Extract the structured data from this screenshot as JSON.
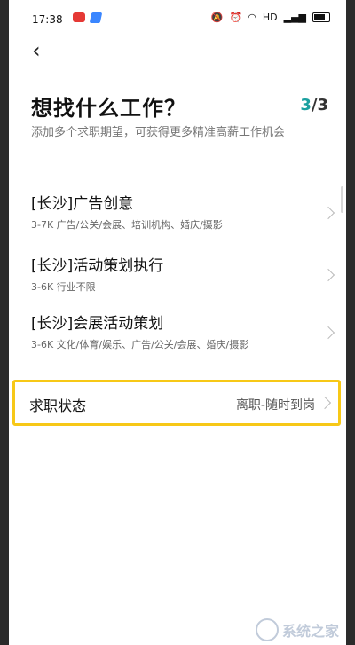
{
  "status_bar": {
    "time": "17:38",
    "right_text": "HD",
    "icons": [
      "notification-red-app-icon",
      "blue-app-icon",
      "bell-icon",
      "alarm-icon",
      "wifi-icon",
      "signal-icon",
      "battery-icon"
    ]
  },
  "header": {
    "back_icon": "chevron-left-icon",
    "title": "想找什么工作？",
    "step_current": "3",
    "step_separator": "/",
    "step_total": "3",
    "subtitle": "添加多个求职期望，可获得更多精准高薪工作机会"
  },
  "jobs": [
    {
      "title": "[长沙]广告创意",
      "desc": "3-7K 广告/公关/会展、培训机构、婚庆/摄影"
    },
    {
      "title": "[长沙]活动策划执行",
      "desc": "3-6K 行业不限"
    },
    {
      "title": "[长沙]会展活动策划",
      "desc": "3-6K 文化/体育/娱乐、广告/公关/会展、婚庆/摄影"
    }
  ],
  "job_status": {
    "label": "求职状态",
    "value": "离职-随时到岗"
  },
  "watermark": {
    "text": "系统之家"
  },
  "colors": {
    "accent": "#1aa0a0",
    "highlight_border": "#f7c817"
  }
}
